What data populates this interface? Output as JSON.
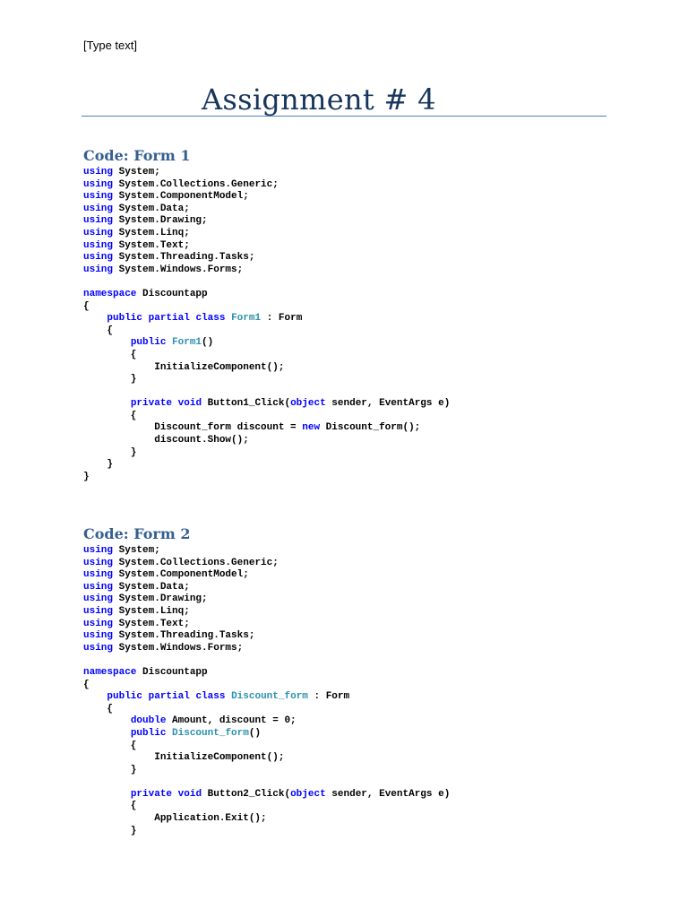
{
  "header_text": "[Type text]",
  "title": "Assignment # 4",
  "colors": {
    "keyword": "#0000ff",
    "type": "#2b91af",
    "heading": "#365f91",
    "title": "#17365d",
    "rule": "#4f81bd"
  },
  "sections": [
    {
      "heading": "Code: Form 1",
      "code": [
        [
          [
            "using",
            "kw"
          ],
          [
            " System;",
            ""
          ]
        ],
        [
          [
            "using",
            "kw"
          ],
          [
            " System.Collections.Generic;",
            ""
          ]
        ],
        [
          [
            "using",
            "kw"
          ],
          [
            " System.ComponentModel;",
            ""
          ]
        ],
        [
          [
            "using",
            "kw"
          ],
          [
            " System.Data;",
            ""
          ]
        ],
        [
          [
            "using",
            "kw"
          ],
          [
            " System.Drawing;",
            ""
          ]
        ],
        [
          [
            "using",
            "kw"
          ],
          [
            " System.Linq;",
            ""
          ]
        ],
        [
          [
            "using",
            "kw"
          ],
          [
            " System.Text;",
            ""
          ]
        ],
        [
          [
            "using",
            "kw"
          ],
          [
            " System.Threading.Tasks;",
            ""
          ]
        ],
        [
          [
            "using",
            "kw"
          ],
          [
            " System.Windows.Forms;",
            ""
          ]
        ],
        [],
        [
          [
            "namespace",
            "kw"
          ],
          [
            " Discountapp",
            ""
          ]
        ],
        [
          [
            "{",
            ""
          ]
        ],
        [
          [
            "    ",
            ""
          ],
          [
            "public",
            "kw"
          ],
          [
            " ",
            ""
          ],
          [
            "partial",
            "kw"
          ],
          [
            " ",
            ""
          ],
          [
            "class",
            "kw"
          ],
          [
            " ",
            ""
          ],
          [
            "Form1",
            "ty"
          ],
          [
            " : Form",
            ""
          ]
        ],
        [
          [
            "    {",
            ""
          ]
        ],
        [
          [
            "        ",
            ""
          ],
          [
            "public",
            "kw"
          ],
          [
            " ",
            ""
          ],
          [
            "Form1",
            "ty"
          ],
          [
            "()",
            ""
          ]
        ],
        [
          [
            "        {",
            ""
          ]
        ],
        [
          [
            "            InitializeComponent();",
            ""
          ]
        ],
        [
          [
            "        }",
            ""
          ]
        ],
        [],
        [
          [
            "        ",
            ""
          ],
          [
            "private",
            "kw"
          ],
          [
            " ",
            ""
          ],
          [
            "void",
            "kw"
          ],
          [
            " Button1_Click(",
            ""
          ],
          [
            "object",
            "kw"
          ],
          [
            " sender, EventArgs e)",
            ""
          ]
        ],
        [
          [
            "        {",
            ""
          ]
        ],
        [
          [
            "            Discount_form discount = ",
            ""
          ],
          [
            "new",
            "kw"
          ],
          [
            " Discount_form();",
            ""
          ]
        ],
        [
          [
            "            discount.Show();",
            ""
          ]
        ],
        [
          [
            "        }",
            ""
          ]
        ],
        [
          [
            "    }",
            ""
          ]
        ],
        [
          [
            "}",
            ""
          ]
        ]
      ]
    },
    {
      "heading": "Code: Form 2",
      "code": [
        [
          [
            "using",
            "kw"
          ],
          [
            " System;",
            ""
          ]
        ],
        [
          [
            "using",
            "kw"
          ],
          [
            " System.Collections.Generic;",
            ""
          ]
        ],
        [
          [
            "using",
            "kw"
          ],
          [
            " System.ComponentModel;",
            ""
          ]
        ],
        [
          [
            "using",
            "kw"
          ],
          [
            " System.Data;",
            ""
          ]
        ],
        [
          [
            "using",
            "kw"
          ],
          [
            " System.Drawing;",
            ""
          ]
        ],
        [
          [
            "using",
            "kw"
          ],
          [
            " System.Linq;",
            ""
          ]
        ],
        [
          [
            "using",
            "kw"
          ],
          [
            " System.Text;",
            ""
          ]
        ],
        [
          [
            "using",
            "kw"
          ],
          [
            " System.Threading.Tasks;",
            ""
          ]
        ],
        [
          [
            "using",
            "kw"
          ],
          [
            " System.Windows.Forms;",
            ""
          ]
        ],
        [],
        [
          [
            "namespace",
            "kw"
          ],
          [
            " Discountapp",
            ""
          ]
        ],
        [
          [
            "{",
            ""
          ]
        ],
        [
          [
            "    ",
            ""
          ],
          [
            "public",
            "kw"
          ],
          [
            " ",
            ""
          ],
          [
            "partial",
            "kw"
          ],
          [
            " ",
            ""
          ],
          [
            "class",
            "kw"
          ],
          [
            " ",
            ""
          ],
          [
            "Discount_form",
            "ty"
          ],
          [
            " : Form",
            ""
          ]
        ],
        [
          [
            "    {",
            ""
          ]
        ],
        [
          [
            "        ",
            ""
          ],
          [
            "double",
            "kw"
          ],
          [
            " Amount, discount = 0;",
            ""
          ]
        ],
        [
          [
            "        ",
            ""
          ],
          [
            "public",
            "kw"
          ],
          [
            " ",
            ""
          ],
          [
            "Discount_form",
            "ty"
          ],
          [
            "()",
            ""
          ]
        ],
        [
          [
            "        {",
            ""
          ]
        ],
        [
          [
            "            InitializeComponent();",
            ""
          ]
        ],
        [
          [
            "        }",
            ""
          ]
        ],
        [],
        [
          [
            "        ",
            ""
          ],
          [
            "private",
            "kw"
          ],
          [
            " ",
            ""
          ],
          [
            "void",
            "kw"
          ],
          [
            " Button2_Click(",
            ""
          ],
          [
            "object",
            "kw"
          ],
          [
            " sender, EventArgs e)",
            ""
          ]
        ],
        [
          [
            "        {",
            ""
          ]
        ],
        [
          [
            "            Application.Exit();",
            ""
          ]
        ],
        [
          [
            "        }",
            ""
          ]
        ]
      ]
    }
  ]
}
